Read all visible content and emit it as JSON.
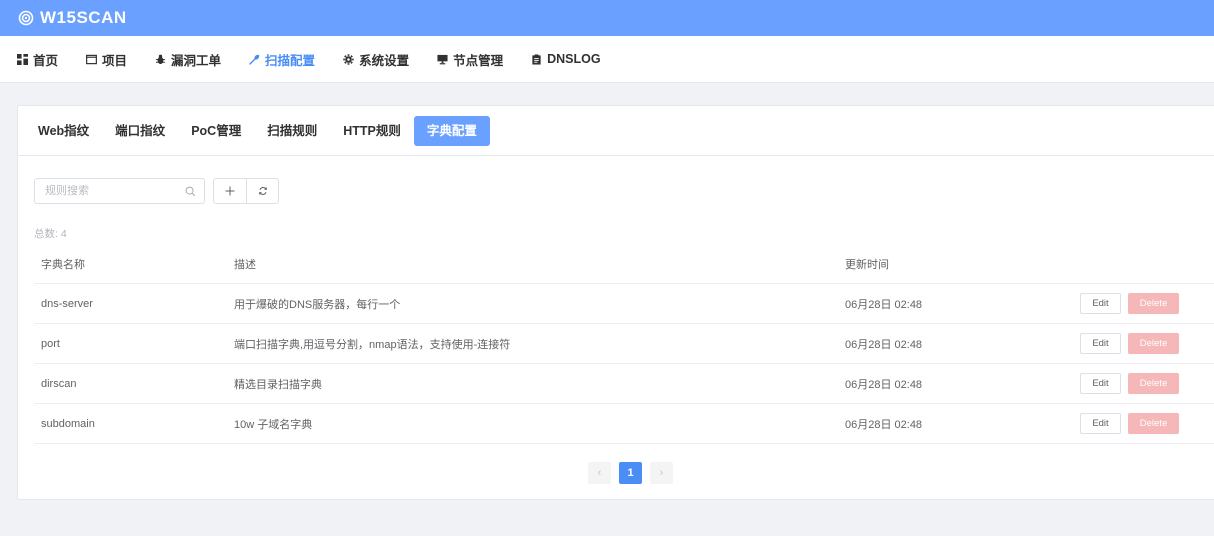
{
  "app": {
    "brand": "W15SCAN"
  },
  "nav": [
    {
      "label": "首页",
      "icon": "dashboard-icon"
    },
    {
      "label": "项目",
      "icon": "window-icon"
    },
    {
      "label": "漏洞工单",
      "icon": "bug-icon"
    },
    {
      "label": "扫描配置",
      "icon": "wrench-icon",
      "active": true
    },
    {
      "label": "系统设置",
      "icon": "gear-icon"
    },
    {
      "label": "节点管理",
      "icon": "monitor-icon"
    },
    {
      "label": "DNSLOG",
      "icon": "clipboard-icon"
    }
  ],
  "tabs": [
    {
      "label": "Web指纹"
    },
    {
      "label": "端口指纹"
    },
    {
      "label": "PoC管理"
    },
    {
      "label": "扫描规则"
    },
    {
      "label": "HTTP规则"
    },
    {
      "label": "字典配置",
      "active": true
    }
  ],
  "search": {
    "placeholder": "规则搜索",
    "value": ""
  },
  "total_label": "总数: 4",
  "table": {
    "headers": {
      "name": "字典名称",
      "desc": "描述",
      "time": "更新时间"
    },
    "rows": [
      {
        "name": "dns-server",
        "desc": "用于爆破的DNS服务器，每行一个",
        "time": "06月28日 02:48",
        "edit": "Edit",
        "delete": "Delete"
      },
      {
        "name": "port",
        "desc": "端口扫描字典,用逗号分割，nmap语法，支持使用-连接符",
        "time": "06月28日 02:48",
        "edit": "Edit",
        "delete": "Delete"
      },
      {
        "name": "dirscan",
        "desc": "精选目录扫描字典",
        "time": "06月28日 02:48",
        "edit": "Edit",
        "delete": "Delete"
      },
      {
        "name": "subdomain",
        "desc": "10w 子域名字典",
        "time": "06月28日 02:48",
        "edit": "Edit",
        "delete": "Delete"
      }
    ]
  },
  "pagination": {
    "current": "1",
    "prev": "‹",
    "next": "›"
  },
  "colors": {
    "accent": "#6aa0ff",
    "active_text": "#4a8ef5",
    "danger_light": "#f5b7b7"
  }
}
